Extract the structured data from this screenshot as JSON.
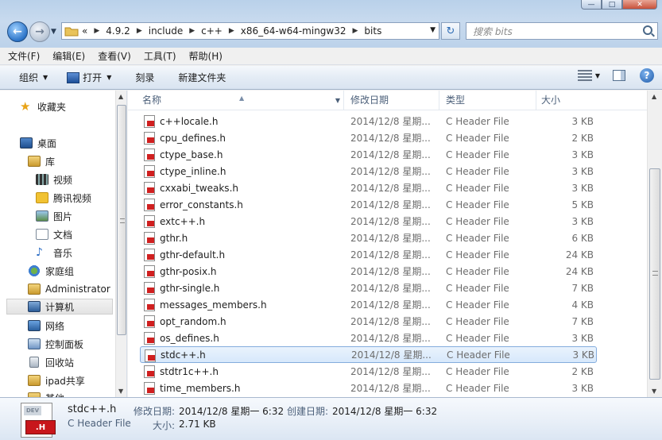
{
  "window": {
    "search_placeholder": "搜索 bits",
    "colors": {
      "title_glass": "#b9d1ea",
      "selected_row": "#d7e8fb",
      "header_badge": "#c8161b"
    }
  },
  "address": {
    "overflow": "«",
    "crumbs": [
      "4.9.2",
      "include",
      "c++",
      "x86_64-w64-mingw32",
      "bits"
    ]
  },
  "menu": [
    "文件(F)",
    "编辑(E)",
    "查看(V)",
    "工具(T)",
    "帮助(H)"
  ],
  "toolbar": {
    "organize": "组织",
    "open": "打开",
    "burn": "刻录",
    "new_folder": "新建文件夹"
  },
  "nav": {
    "items": [
      {
        "label": "收藏夹",
        "icon": "star-icon"
      },
      {
        "label": "桌面",
        "icon": "desktop-icon"
      },
      {
        "label": "库",
        "icon": "library-icon"
      },
      {
        "label": "视频",
        "icon": "video-icon"
      },
      {
        "label": "腾讯视频",
        "icon": "tencent-video-icon"
      },
      {
        "label": "图片",
        "icon": "pictures-icon"
      },
      {
        "label": "文档",
        "icon": "documents-icon"
      },
      {
        "label": "音乐",
        "icon": "music-icon"
      },
      {
        "label": "家庭组",
        "icon": "homegroup-icon"
      },
      {
        "label": "Administrator",
        "icon": "user-folder-icon"
      },
      {
        "label": "计算机",
        "icon": "computer-icon"
      },
      {
        "label": "网络",
        "icon": "network-icon"
      },
      {
        "label": "控制面板",
        "icon": "control-panel-icon"
      },
      {
        "label": "回收站",
        "icon": "recycle-bin-icon"
      },
      {
        "label": "ipad共享",
        "icon": "folder-icon"
      },
      {
        "label": "其他",
        "icon": "folder-icon"
      }
    ]
  },
  "columns": {
    "name": "名称",
    "date": "修改日期",
    "type": "类型",
    "size": "大小"
  },
  "files": [
    {
      "name": "c++locale.h",
      "date": "2014/12/8 星期...",
      "type": "C Header File",
      "size": "3 KB"
    },
    {
      "name": "cpu_defines.h",
      "date": "2014/12/8 星期...",
      "type": "C Header File",
      "size": "2 KB"
    },
    {
      "name": "ctype_base.h",
      "date": "2014/12/8 星期...",
      "type": "C Header File",
      "size": "3 KB"
    },
    {
      "name": "ctype_inline.h",
      "date": "2014/12/8 星期...",
      "type": "C Header File",
      "size": "3 KB"
    },
    {
      "name": "cxxabi_tweaks.h",
      "date": "2014/12/8 星期...",
      "type": "C Header File",
      "size": "3 KB"
    },
    {
      "name": "error_constants.h",
      "date": "2014/12/8 星期...",
      "type": "C Header File",
      "size": "5 KB"
    },
    {
      "name": "extc++.h",
      "date": "2014/12/8 星期...",
      "type": "C Header File",
      "size": "3 KB"
    },
    {
      "name": "gthr.h",
      "date": "2014/12/8 星期...",
      "type": "C Header File",
      "size": "6 KB"
    },
    {
      "name": "gthr-default.h",
      "date": "2014/12/8 星期...",
      "type": "C Header File",
      "size": "24 KB"
    },
    {
      "name": "gthr-posix.h",
      "date": "2014/12/8 星期...",
      "type": "C Header File",
      "size": "24 KB"
    },
    {
      "name": "gthr-single.h",
      "date": "2014/12/8 星期...",
      "type": "C Header File",
      "size": "7 KB"
    },
    {
      "name": "messages_members.h",
      "date": "2014/12/8 星期...",
      "type": "C Header File",
      "size": "4 KB"
    },
    {
      "name": "opt_random.h",
      "date": "2014/12/8 星期...",
      "type": "C Header File",
      "size": "7 KB"
    },
    {
      "name": "os_defines.h",
      "date": "2014/12/8 星期...",
      "type": "C Header File",
      "size": "3 KB"
    },
    {
      "name": "stdc++.h",
      "date": "2014/12/8 星期...",
      "type": "C Header File",
      "size": "3 KB",
      "selected": true
    },
    {
      "name": "stdtr1c++.h",
      "date": "2014/12/8 星期...",
      "type": "C Header File",
      "size": "2 KB"
    },
    {
      "name": "time_members.h",
      "date": "2014/12/8 星期...",
      "type": "C Header File",
      "size": "3 KB"
    }
  ],
  "details": {
    "icon_dev": "DEV",
    "icon_ext": ".H",
    "name": "stdc++.h",
    "type": "C Header File",
    "modified_label": "修改日期:",
    "modified_value": "2014/12/8 星期一 6:32",
    "created_label": "创建日期:",
    "created_value": "2014/12/8 星期一 6:32",
    "size_label": "大小:",
    "size_value": "2.71 KB"
  }
}
